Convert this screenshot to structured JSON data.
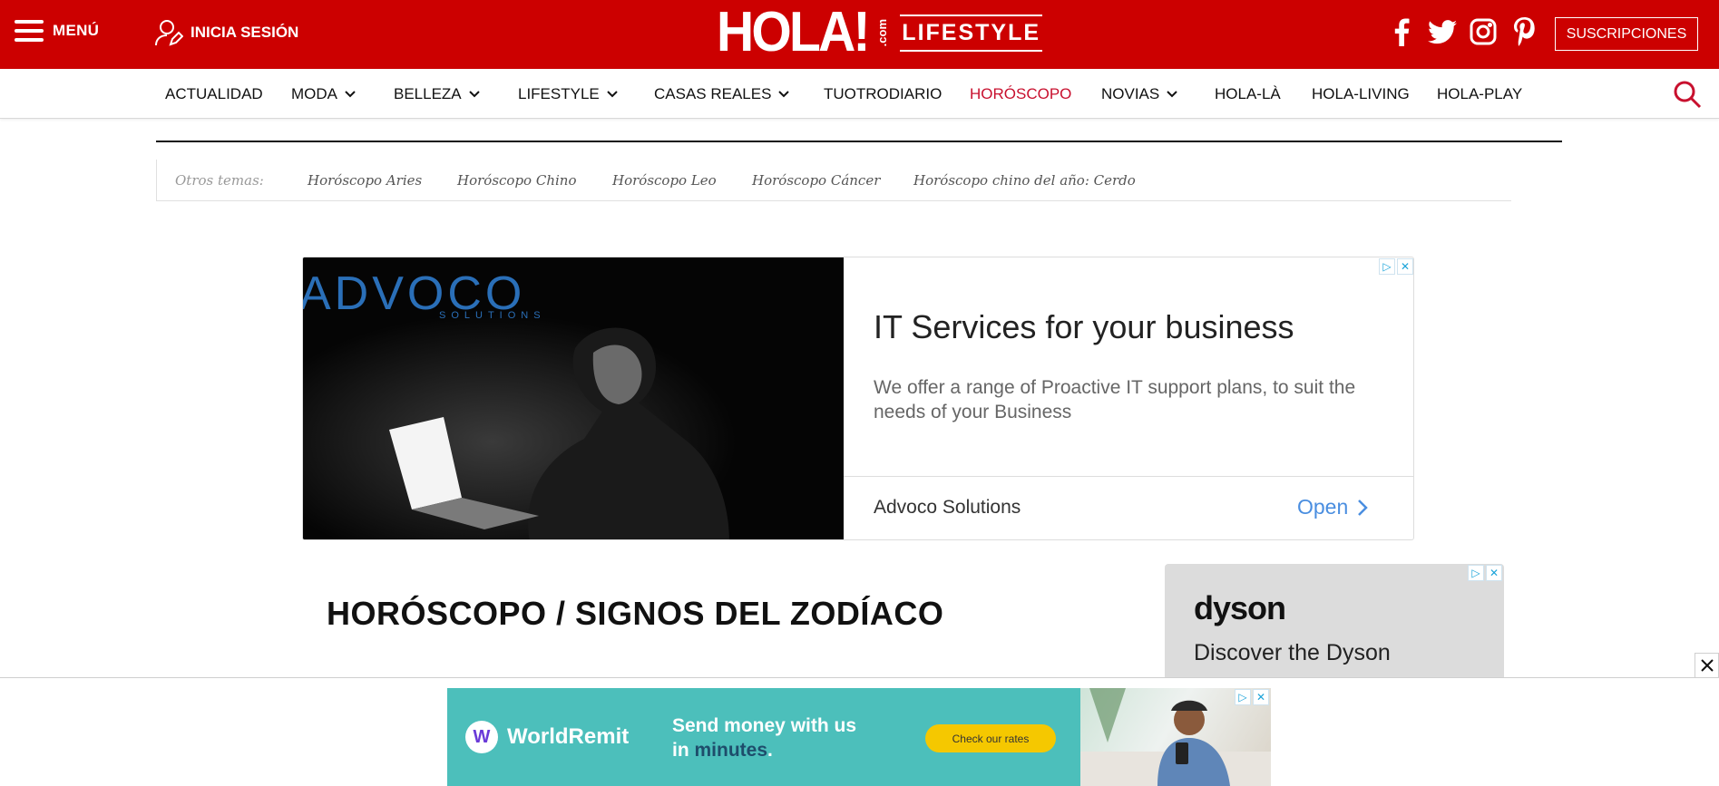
{
  "header": {
    "menu_label": "MENÚ",
    "login_label": "INICIA SESIÓN",
    "logo_main": "HOLA!",
    "logo_com": ".com",
    "logo_section": "LIFESTYLE",
    "subscribe_label": "SUSCRIPCIONES",
    "social": [
      "facebook-icon",
      "twitter-icon",
      "instagram-icon",
      "pinterest-icon"
    ],
    "brand_color": "#cc0000"
  },
  "nav": {
    "items": [
      {
        "label": "ACTUALIDAD",
        "dropdown": false
      },
      {
        "label": "MODA",
        "dropdown": true
      },
      {
        "label": "BELLEZA",
        "dropdown": true
      },
      {
        "label": "LIFESTYLE",
        "dropdown": true
      },
      {
        "label": "CASAS REALES",
        "dropdown": true
      },
      {
        "label": "TUOTRODIARIO",
        "dropdown": false
      },
      {
        "label": "HORÓSCOPO",
        "dropdown": false,
        "active": true
      },
      {
        "label": "NOVIAS",
        "dropdown": true
      },
      {
        "label": "HOLA-LÀ",
        "dropdown": false
      },
      {
        "label": "HOLA-LIVING",
        "dropdown": false
      },
      {
        "label": "HOLA-PLAY",
        "dropdown": false
      }
    ],
    "active_color": "#c8102e"
  },
  "topics": {
    "label": "Otros temas:",
    "links": [
      "Horóscopo Aries",
      "Horóscopo Chino",
      "Horóscopo Leo",
      "Horóscopo Cáncer",
      "Horóscopo chino del año: Cerdo"
    ]
  },
  "ad_main": {
    "brand": "ADVOCO",
    "brand_sub": "SOLUTIONS",
    "title": "IT Services for your business",
    "description": "We offer a range of Proactive IT support plans, to suit the needs of your Business",
    "advertiser": "Advoco Solutions",
    "cta": "Open"
  },
  "page": {
    "title": "HORÓSCOPO / SIGNOS DEL ZODÍACO"
  },
  "ad_side": {
    "brand": "dyson",
    "text": "Discover the Dyson"
  },
  "ad_sticky": {
    "brand": "WorldRemit",
    "line1": "Send money with us",
    "line2_prefix": "in ",
    "line2_highlight": "minutes",
    "line2_suffix": ".",
    "cta": "Check our rates",
    "bg_color": "#4cbfbb"
  }
}
